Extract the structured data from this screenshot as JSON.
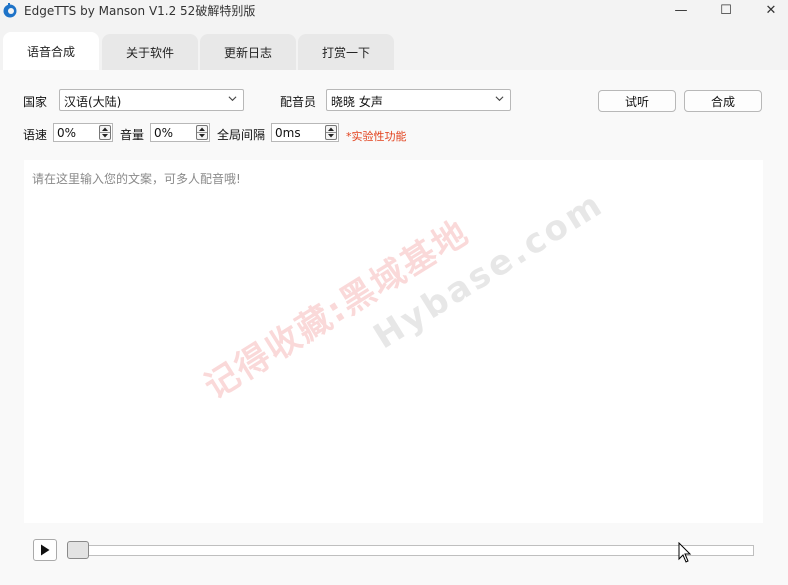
{
  "window": {
    "title": "EdgeTTS by Manson V1.2 52破解特别版",
    "min_glyph": "—",
    "max_glyph": "☐",
    "close_glyph": "✕"
  },
  "tabs": [
    {
      "label": "语音合成",
      "active": true
    },
    {
      "label": "关于软件",
      "active": false
    },
    {
      "label": "更新日志",
      "active": false
    },
    {
      "label": "打赏一下",
      "active": false
    }
  ],
  "form": {
    "country_label": "国家",
    "country_value": "汉语(大陆)",
    "voice_label": "配音员",
    "voice_value": "晓晓 女声",
    "preview_button": "试听",
    "synthesize_button": "合成",
    "speed_label": "语速",
    "speed_value": "0%",
    "volume_label": "音量",
    "volume_value": "0%",
    "gap_label": "全局间隔",
    "gap_value": "0ms",
    "experimental_note": "*实验性功能"
  },
  "editor": {
    "placeholder": "请在这里输入您的文案，可多人配音哦!"
  },
  "watermark": {
    "line1": "记得收藏:黑域基地",
    "line2": "Hybase.com"
  },
  "player": {
    "progress": 0
  },
  "colors": {
    "accent_note": "#e2401b",
    "app_icon": "#1e73c8"
  }
}
